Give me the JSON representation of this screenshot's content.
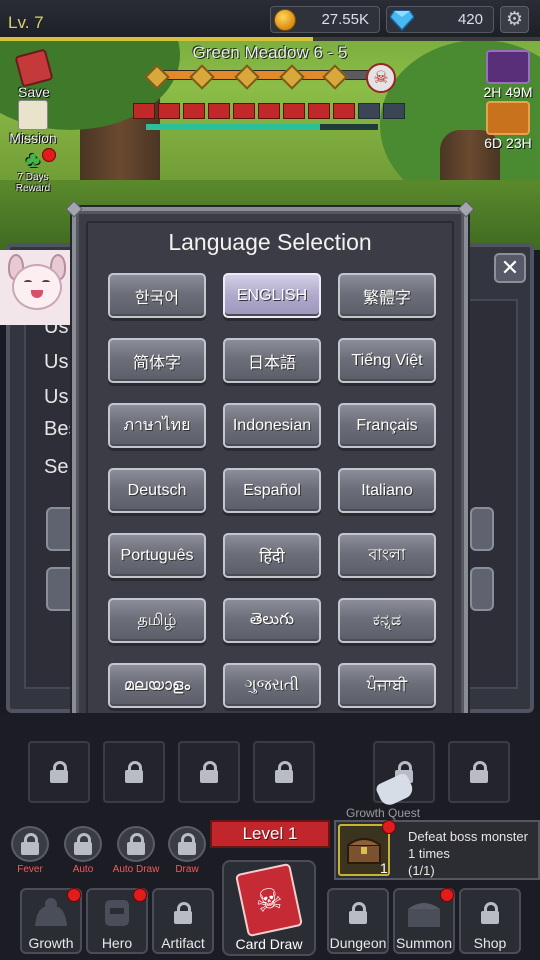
{
  "player": {
    "level": "Lv. 7",
    "xp_fraction": 0.58
  },
  "currency": {
    "gold": "27.55K",
    "gems": "420",
    "gold_icon": "coin-icon",
    "gem_icon": "diamond-icon"
  },
  "stage": {
    "title": "Green Meadow 6 - 5",
    "progress_fraction": 0.82,
    "boss_hp_cells": 11,
    "boss_hp_filled": 9,
    "mp_fraction": 0.75
  },
  "left_menu": {
    "save": "Save",
    "mission": "Mission",
    "reward": "7 Days\nReward"
  },
  "right_timers": [
    {
      "label": "2H 49M"
    },
    {
      "label": "6D 23H"
    }
  ],
  "underlying_panel": {
    "lines": [
      "Us",
      "Us",
      "Us",
      "Bes",
      "Se"
    ]
  },
  "language_modal": {
    "title": "Language Selection",
    "selected": "ENGLISH",
    "languages": [
      "한국어",
      "ENGLISH",
      "繁體字",
      "简体字",
      "日本語",
      "Tiếng Việt",
      "ภาษาไทย",
      "Indonesian",
      "Français",
      "Deutsch",
      "Español",
      "Italiano",
      "Português",
      "हिंदी",
      "বাংলা",
      "தமிழ்",
      "తెలుగు",
      "ಕನ್ನಡ",
      "മലയാളം",
      "ગુજરાતી",
      "ਪੰਜਾਬੀ"
    ],
    "close_symbol": "✕"
  },
  "skills": [
    {
      "label": "Fever"
    },
    {
      "label": "Auto"
    },
    {
      "label": "Auto Draw"
    },
    {
      "label": "Draw"
    }
  ],
  "card_level": "Level 1",
  "quest": {
    "header": "Growth Quest",
    "text": "Defeat boss monster 1 times",
    "progress": "(1/1)",
    "count": "1"
  },
  "nav": [
    {
      "label": "Growth"
    },
    {
      "label": "Hero"
    },
    {
      "label": "Artifact"
    },
    {
      "label": "Card Draw"
    },
    {
      "label": "Dungeon"
    },
    {
      "label": "Summon"
    },
    {
      "label": "Shop"
    }
  ],
  "colors": {
    "accent_red": "#c0262c",
    "gold": "#d6c13a",
    "selected_lang": "#b0a9cc"
  }
}
